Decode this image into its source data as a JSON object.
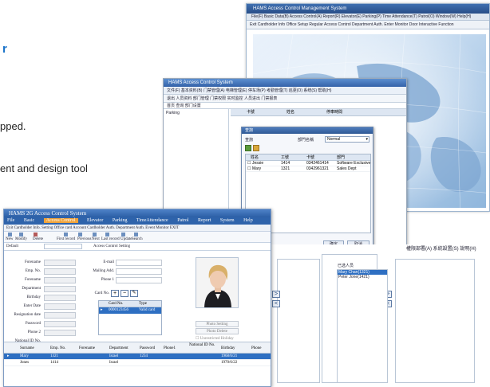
{
  "page": {
    "fragments": {
      "r_char": "r",
      "pped": "pped.",
      "design_tool": "ent and design tool"
    }
  },
  "back_window": {
    "title": "HAMS Access Control Management System",
    "menu": "File(F)   Basic Data(B)   Access Control(A)   Report(R)   Elevator(E)   Parking(P)   Time Attendance(T)   Patrol(O)   Window(W)   Help(H)",
    "toolbar": "Exit   Cardholder Info   Office Setup   Regular Access Control   Department Auth.   Enter Monitor   Door Interactive Function"
  },
  "mid_window": {
    "title": "HAMS Access Control System",
    "menu": "文件(F)  基本资料(B)  门禁管理(A)  电梯管理(E)  停车场(P)  考勤管理(T)  巡更(O)  系统(S)  帮助(H)",
    "toolbar": "退出  人员资料  部门管理  门禁权限  实时监控  人员进出  门禁报表",
    "nav": "首页  查询  部门设置",
    "left_pane_label": "Parking",
    "grid_headers": [
      "卡號",
      "姓名",
      "停車時間"
    ]
  },
  "dialog": {
    "title": "查詢",
    "filter_label": "查詢",
    "dept_label": "部門名稱",
    "dept_value": "Normal",
    "headers": [
      "姓名",
      "工號",
      "卡號",
      "部門"
    ],
    "rows": [
      [
        "Jessie",
        "1414",
        "0342461414",
        "Software Exclusive"
      ],
      [
        "Mary",
        "1321",
        "0342961321",
        "Sales Dept"
      ]
    ],
    "ok_label": "确定",
    "cancel_label": "取消"
  },
  "right_window": {
    "menu": "權限部署(A)   系統設置(S)   說明(H)",
    "selected_label": "已选人员",
    "selected_items": [
      "Mary Chan(1321)",
      "Peter Jone(1421)"
    ],
    "arrow_right": ">",
    "arrow_left": "<"
  },
  "front_window": {
    "title": "HAMS 2G Access Control System",
    "menu": [
      "File",
      "Basic",
      "Access Control",
      "Elevator",
      "Parking",
      "TimeAttendance",
      "Patrol",
      "Report",
      "System",
      "Help"
    ],
    "active_menu": "Access Control",
    "subtoolbar": "Exit   Cardholder Info. Setting   Office card Account   Cardholder Auth.   Department Auth.   Event Monitor   EXIT",
    "tools": [
      "New",
      "Modify",
      "Delete",
      "First record",
      "Previous",
      "Next",
      "Last record",
      "Update",
      "Search"
    ],
    "filter_label": "Default",
    "filter_btn": "Access Control Setting",
    "fields_left": [
      "Forename",
      "Emp. No.",
      "Forename",
      "Department",
      "Birthday",
      "Enter Date",
      "Resignation date",
      "Password",
      "Phone 2",
      "National ID No."
    ],
    "fields_right": [
      "E-mail",
      "Mailing Add.",
      "Phone 1"
    ],
    "card_label": "Card No.",
    "card_headers": [
      "Card No.",
      "Type"
    ],
    "card_row": [
      "0000123456",
      "Valid card"
    ],
    "photo_buttons": [
      "Photo Setting",
      "Photo Delete"
    ],
    "checkboxes": [
      "Unrestricted Holiday",
      "Unrestricted Time Zone"
    ],
    "table_headers": [
      "Surname",
      "Emp. No.",
      "Forename",
      "Department",
      "Password",
      "Phone1",
      "National ID No.",
      "Birthday",
      "Phone"
    ],
    "table_rows": [
      {
        "surname": "Mary",
        "emp": "1321",
        "forename": "",
        "dept": "Israel",
        "password": "1234",
        "phone1": "",
        "natid": "",
        "birthday": "1968/6/21",
        "selected": true
      },
      {
        "surname": "Jones",
        "emp": "1414",
        "forename": "",
        "dept": "Israel",
        "password": "",
        "phone1": "",
        "natid": "",
        "birthday": "1970/6/22",
        "selected": false
      }
    ]
  },
  "colors": {
    "accent": "#1a73c9",
    "title_bar": "#2b5ea5",
    "menu_active": "#f0a33a",
    "selection": "#2e6fc2"
  }
}
